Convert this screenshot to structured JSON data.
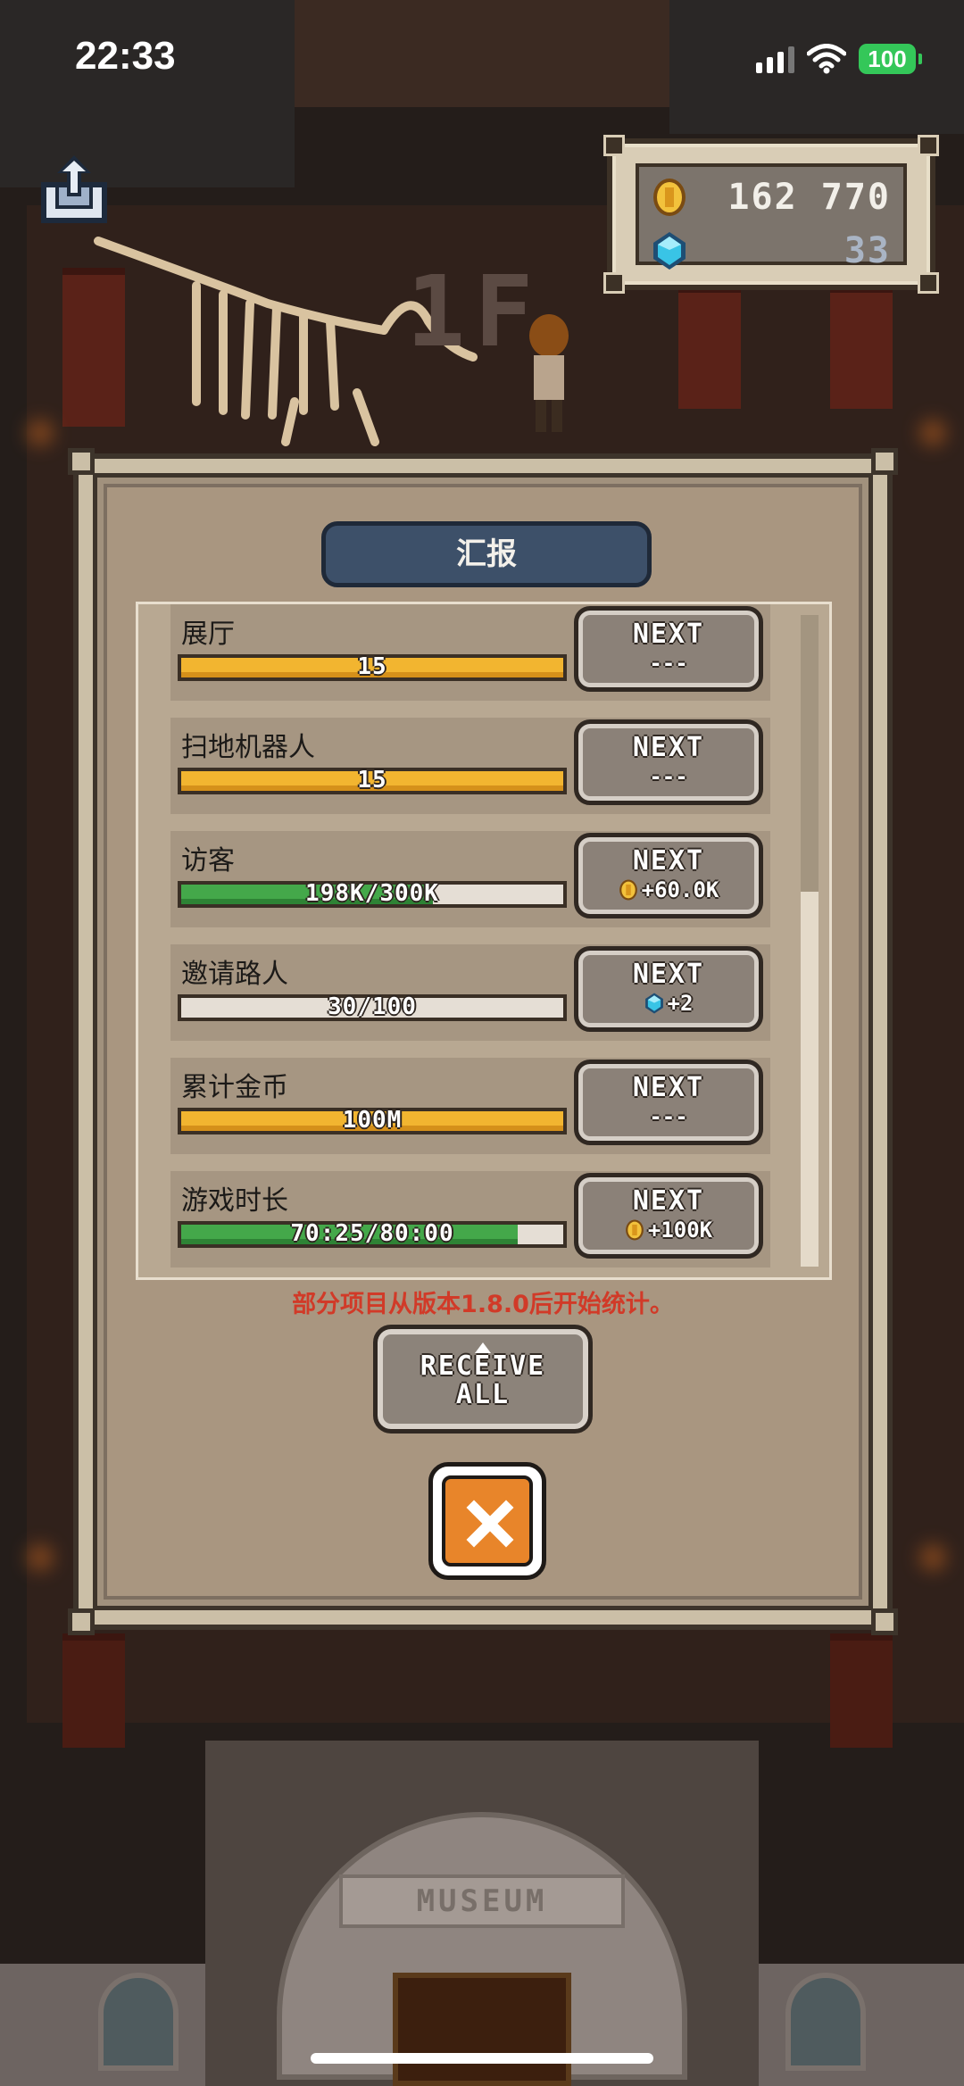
{
  "status_bar": {
    "time": "22:33",
    "battery": "100"
  },
  "currency": {
    "coins": "162 770",
    "gems": "33",
    "coin_icon": "gold-coin-icon",
    "gem_icon": "blue-gem-icon"
  },
  "scene": {
    "floor_sign": "1F",
    "museum_sign": "MUSEUM"
  },
  "report": {
    "title": "汇报",
    "items": [
      {
        "label": "展厅",
        "bar_text": "15",
        "progress": 1.0,
        "bar_color": "gold",
        "next_label": "NEXT",
        "reward": "---",
        "reward_icon": ""
      },
      {
        "label": "扫地机器人",
        "bar_text": "15",
        "progress": 1.0,
        "bar_color": "gold",
        "next_label": "NEXT",
        "reward": "---",
        "reward_icon": ""
      },
      {
        "label": "访客",
        "bar_text": "198K/300K",
        "progress": 0.66,
        "bar_color": "green",
        "next_label": "NEXT",
        "reward": "+60.0K",
        "reward_icon": "gold-coin-icon"
      },
      {
        "label": "邀请路人",
        "bar_text": "30/100",
        "progress": 0.0,
        "bar_color": "green",
        "next_label": "NEXT",
        "reward": "+2",
        "reward_icon": "blue-gem-icon"
      },
      {
        "label": "累计金币",
        "bar_text": "100M",
        "progress": 1.0,
        "bar_color": "gold",
        "next_label": "NEXT",
        "reward": "---",
        "reward_icon": ""
      },
      {
        "label": "游戏时长",
        "bar_text": "70:25/80:00",
        "progress": 0.88,
        "bar_color": "green",
        "next_label": "NEXT",
        "reward": "+100K",
        "reward_icon": "gold-coin-icon"
      }
    ],
    "note": "部分项目从版本1.8.0后开始统计。",
    "receive_all": "RECEIVE\nALL"
  },
  "colors": {
    "gold_bar": "#f2b530",
    "green_bar": "#44a84a",
    "title_pill": "#3d5069",
    "close_button": "#e8852a",
    "note_red": "#d13a28"
  }
}
